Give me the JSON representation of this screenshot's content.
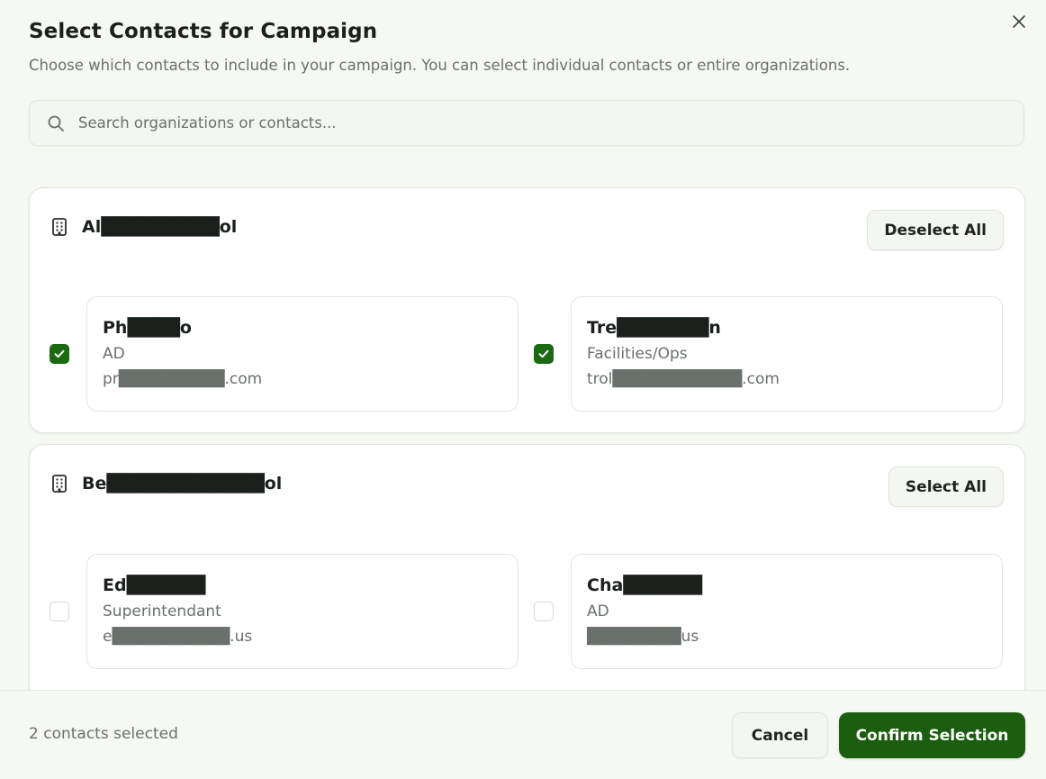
{
  "dialog": {
    "title": "Select Contacts for Campaign",
    "subtitle": "Choose which contacts to include in your campaign. You can select individual contacts or entire organizations.",
    "close_icon": "close-icon"
  },
  "search": {
    "placeholder": "Search organizations or contacts...",
    "value": "",
    "icon": "search-icon"
  },
  "organizations": [
    {
      "name": "Al█████████ol",
      "icon": "building-icon",
      "action_label": "Deselect All",
      "contacts": [
        {
          "name": "Ph████o",
          "role": "AD",
          "email": "pr█████████.com",
          "checked": true
        },
        {
          "name": "Tre███████n",
          "role": "Facilities/Ops",
          "email": "trol███████████.com",
          "checked": true
        }
      ]
    },
    {
      "name": "Be████████████ol",
      "icon": "building-icon",
      "action_label": "Select All",
      "contacts": [
        {
          "name": "Ed██████",
          "role": "Superintendant",
          "email": "e██████████.us",
          "checked": false
        },
        {
          "name": "Cha██████",
          "role": "AD",
          "email": "████████us",
          "checked": false
        }
      ]
    }
  ],
  "footer": {
    "selected_count": "2 contacts selected",
    "cancel_label": "Cancel",
    "confirm_label": "Confirm Selection"
  },
  "colors": {
    "accent": "#1b5e0f",
    "checkbox_checked": "#1b6a12",
    "background": "#f6f8f3"
  }
}
